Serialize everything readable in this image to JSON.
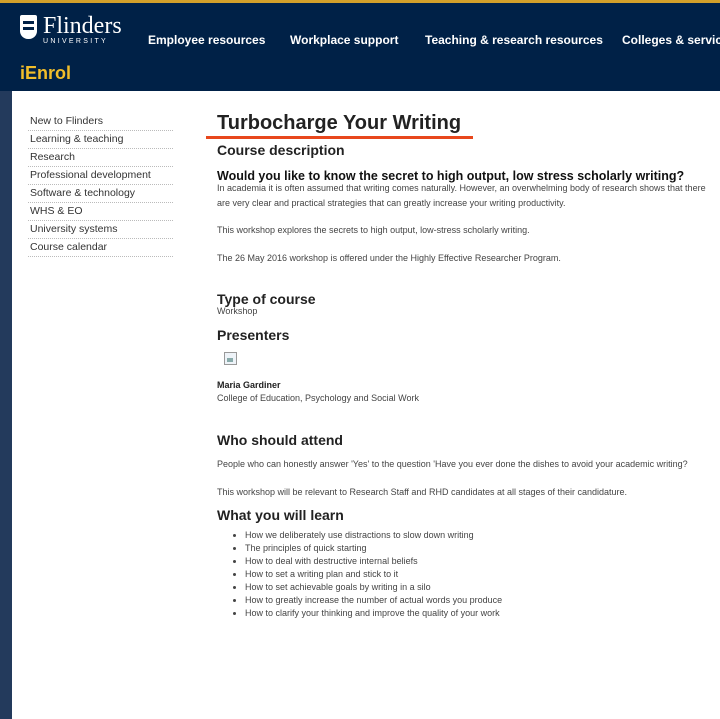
{
  "brand": {
    "name": "Flinders",
    "subname": "UNIVERSITY",
    "app": "iEnrol"
  },
  "topnav": [
    "Employee resources",
    "Workplace support",
    "Teaching & research resources",
    "Colleges & services"
  ],
  "sidebar": [
    "New to Flinders",
    "Learning & teaching",
    "Research",
    "Professional development",
    "Software & technology",
    "WHS & EO",
    "University systems",
    "Course calendar"
  ],
  "content": {
    "title": "Turbocharge Your Writing",
    "course_description_heading": "Course description",
    "question": "Would you like to know the secret to high output, low stress scholarly writing?",
    "intro": "In academia it is often assumed that writing comes naturally. However, an overwhelming body of research shows that there are very clear and practical strategies that can greatly increase your writing productivity.",
    "explores": "This workshop explores the secrets to high output, low-stress scholarly writing.",
    "program": "The 26 May 2016 workshop is offered under the Highly Effective Researcher Program.",
    "type_heading": "Type of course",
    "type_value": "Workshop",
    "presenters_heading": "Presenters",
    "presenter_name": "Maria Gardiner",
    "presenter_college": "College of Education, Psychology and Social Work",
    "attend_heading": "Who should attend",
    "attend_text": "People who can honestly answer 'Yes' to the question 'Have you ever done the dishes to avoid your academic writing?",
    "relevant_text": "This workshop will be relevant to Research Staff and RHD candidates at all stages of their candidature.",
    "learn_heading": "What you will learn",
    "learn_items": [
      "How we deliberately use distractions to slow down writing",
      "The principles of quick starting",
      "How to deal with destructive internal beliefs",
      "How to set a writing plan and stick to it",
      "How to set achievable goals by writing in a silo",
      "How to greatly increase the number of actual words you produce",
      "How to clarify your thinking and improve the quality of your work"
    ]
  },
  "colors": {
    "header_bg": "#002147",
    "accent_gold": "#f1bd2a",
    "title_rule": "#e8471c",
    "outer_bg": "#233a5c"
  }
}
